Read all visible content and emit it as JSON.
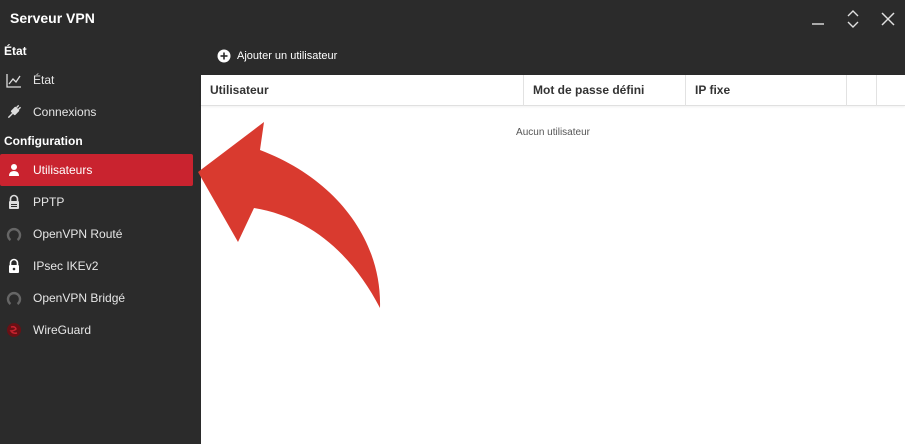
{
  "window": {
    "title": "Serveur VPN"
  },
  "sidebar": {
    "section_status": "État",
    "section_config": "Configuration",
    "items": [
      {
        "label": "État",
        "icon": "chart-line-icon"
      },
      {
        "label": "Connexions",
        "icon": "plug-icon"
      },
      {
        "label": "Utilisateurs",
        "icon": "user-icon",
        "active": true
      },
      {
        "label": "PPTP",
        "icon": "lock-icon"
      },
      {
        "label": "OpenVPN Routé",
        "icon": "openvpn-icon"
      },
      {
        "label": "IPsec IKEv2",
        "icon": "lock-icon"
      },
      {
        "label": "OpenVPN Bridgé",
        "icon": "openvpn-icon"
      },
      {
        "label": "WireGuard",
        "icon": "wireguard-icon"
      }
    ]
  },
  "toolbar": {
    "add_user_label": "Ajouter un utilisateur"
  },
  "table": {
    "columns": [
      "Utilisateur",
      "Mot de passe défini",
      "IP fixe"
    ],
    "empty_message": "Aucun utilisateur"
  },
  "colors": {
    "accent": "#c9232f",
    "arrow": "#d93a2f",
    "background": "#2b2b2b"
  }
}
